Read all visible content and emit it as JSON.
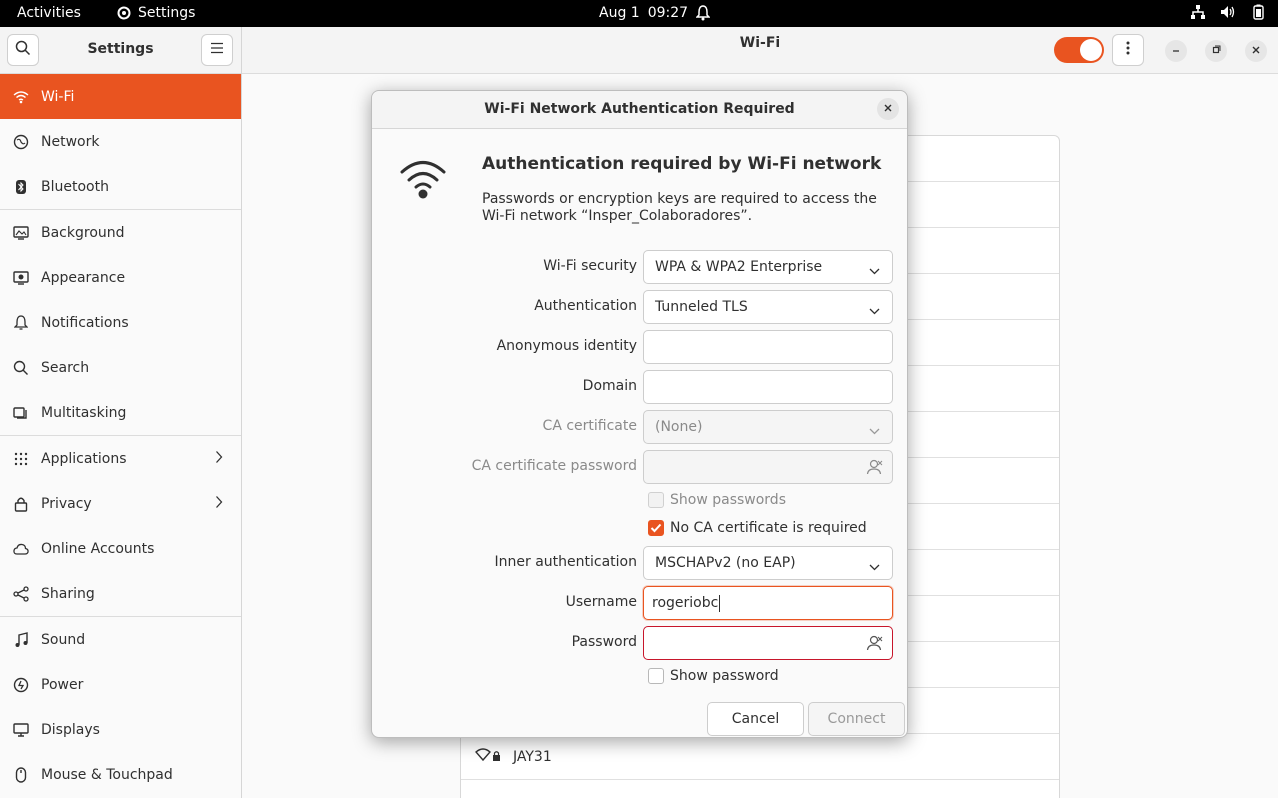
{
  "topbar": {
    "activities": "Activities",
    "app_name": "Settings",
    "date": "Aug 1",
    "time": "09:27"
  },
  "sidebar": {
    "title": "Settings",
    "items": [
      {
        "label": "Wi-Fi",
        "icon": "wifi-icon"
      },
      {
        "label": "Network",
        "icon": "network-icon"
      },
      {
        "label": "Bluetooth",
        "icon": "bluetooth-icon"
      },
      {
        "label": "Background",
        "icon": "background-icon"
      },
      {
        "label": "Appearance",
        "icon": "appearance-icon"
      },
      {
        "label": "Notifications",
        "icon": "bell-icon"
      },
      {
        "label": "Search",
        "icon": "search-icon"
      },
      {
        "label": "Multitasking",
        "icon": "multitasking-icon"
      },
      {
        "label": "Applications",
        "icon": "grid-icon"
      },
      {
        "label": "Privacy",
        "icon": "lock-icon"
      },
      {
        "label": "Online Accounts",
        "icon": "cloud-icon"
      },
      {
        "label": "Sharing",
        "icon": "share-icon"
      },
      {
        "label": "Sound",
        "icon": "music-note-icon"
      },
      {
        "label": "Power",
        "icon": "power-icon"
      },
      {
        "label": "Displays",
        "icon": "display-icon"
      },
      {
        "label": "Mouse & Touchpad",
        "icon": "mouse-icon"
      }
    ]
  },
  "main": {
    "title": "Wi-Fi",
    "wifi_enabled": true,
    "visible_network": "JAY31"
  },
  "dialog": {
    "title": "Wi-Fi Network Authentication Required",
    "heading": "Authentication required by Wi-Fi network",
    "description": "Passwords or encryption keys are required to access the Wi-Fi network “Insper_Colaboradores”.",
    "fields": {
      "wifi_security": {
        "label": "Wi-Fi security",
        "value": "WPA & WPA2 Enterprise"
      },
      "authentication": {
        "label": "Authentication",
        "value": "Tunneled TLS"
      },
      "anonymous_identity": {
        "label": "Anonymous identity",
        "value": ""
      },
      "domain": {
        "label": "Domain",
        "value": ""
      },
      "ca_certificate": {
        "label": "CA certificate",
        "value": "(None)"
      },
      "ca_certificate_password": {
        "label": "CA certificate password",
        "value": ""
      },
      "show_passwords": {
        "label": "Show passwords",
        "checked": false
      },
      "no_ca_required": {
        "label": "No CA certificate is required",
        "checked": true
      },
      "inner_authentication": {
        "label": "Inner authentication",
        "value": "MSCHAPv2 (no EAP)"
      },
      "username": {
        "label": "Username",
        "value": "rogeriobc"
      },
      "password": {
        "label": "Password",
        "value": ""
      },
      "show_password": {
        "label": "Show password",
        "checked": false
      }
    },
    "cancel_label": "Cancel",
    "connect_label": "Connect"
  },
  "colors": {
    "accent": "#e95420",
    "error": "#c7162b"
  }
}
